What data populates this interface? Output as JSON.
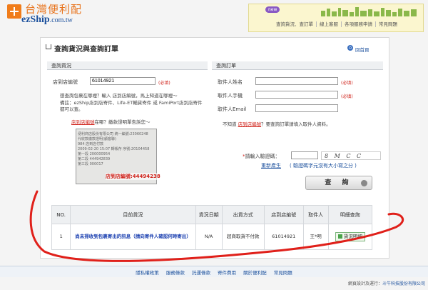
{
  "header": {
    "brand_cn": "台灣便利配",
    "brand_en": "ezShip",
    "brand_domain": ".com.tw",
    "new_badge": "new",
    "top_links": [
      "查詢貨況．查訂單",
      "線上客服",
      "各項服務申請",
      "常見問題"
    ]
  },
  "page": {
    "title": "查詢貨況與查詢訂單",
    "home_link": "回首頁"
  },
  "left_section": {
    "heading": "查詢貨況",
    "store_label": "店到店編號",
    "store_value": "61014921",
    "required": "(必填)",
    "note_line1": "想查詢包裹在哪裡？輸入 店到店編號，馬上知道在哪裡～",
    "note_line2": "備註：ezShip店到店寄件、Life-ET輔貨寄件 或 FamiPort店到店寄件都可以查。",
    "hint_link": "店到店編號",
    "hint_text": "在哪？繳款證明單告訴您～",
    "receipt_lines": [
      "便利商店股份有限公司 統一編號:23060248",
      "代收款繳款證明(顧客聯)",
      "984 店到店付款",
      "2009-02-20 15:07 轉帳存 序號:20104458",
      "第一段 200000954",
      "第二段 444942839",
      "第三段 000017"
    ],
    "receipt_highlight": "店到店編號:44494238"
  },
  "right_section": {
    "heading": "查詢訂單",
    "fields": [
      {
        "label": "取件人姓名",
        "required": "(必填)"
      },
      {
        "label": "取件人手機",
        "required": "(必填)"
      },
      {
        "label": "取件人Email",
        "required": ""
      }
    ],
    "hint_prefix": "不知道 ",
    "hint_link": "店到店編號",
    "hint_suffix": "？要查詢訂單請填入取件人資料。",
    "captcha_label": "請輸入驗證碼：",
    "captcha_text": "8 M C C",
    "regen_link": "重新產生",
    "captcha_note": "( 驗證碼字元沒有大小寫之分 )",
    "query_button": "查 詢"
  },
  "results": {
    "headers": [
      "NO.",
      "目前貨況",
      "貨況日期",
      "出貨方式",
      "店到店編號",
      "取件人",
      "明細查詢"
    ],
    "rows": [
      {
        "no": "1",
        "status": "尚未掃收到包裹寄出的訊息（請向寄件人確認何時寄出）",
        "date": "N/A",
        "method": "超商取貨不付款",
        "store_no": "61014921",
        "receiver": "王*明",
        "detail": "貨況明細"
      }
    ]
  },
  "footer": {
    "links": [
      "隱私權政策",
      "服務條款",
      "託運條款",
      "寄件費用",
      "關於便利配",
      "常見問題"
    ],
    "credit_prefix": "網頁設計及運行：",
    "credit_company": "斗牛科技股份有限公司"
  },
  "colors": {
    "brand_orange": "#f07c1a",
    "brand_blue": "#1a4f9c",
    "required_red": "#d0241c",
    "annotation_red": "#e0201a"
  }
}
